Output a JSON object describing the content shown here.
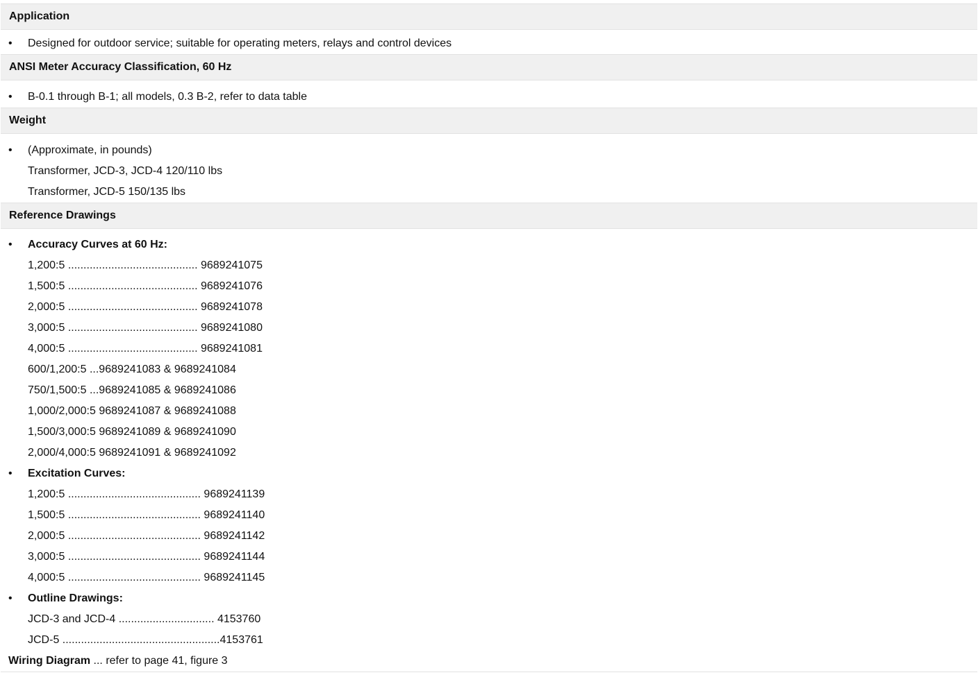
{
  "sections": {
    "application": {
      "title": "Application",
      "items": [
        "Designed for outdoor service; suitable for operating meters, relays and control devices"
      ]
    },
    "accuracy": {
      "title": "ANSI Meter Accuracy Classification, 60 Hz",
      "items": [
        "B-0.1 through B-1; all models, 0.3 B-2, refer to data table"
      ]
    },
    "weight": {
      "title": "Weight",
      "bullet": "(Approximate, in pounds)",
      "lines": [
        "Transformer, JCD-3, JCD-4 120/110 lbs",
        "Transformer, JCD-5 150/135 lbs"
      ]
    },
    "reference": {
      "title": "Reference Drawings",
      "accuracy_curves": {
        "label": "Accuracy Curves at 60 Hz:",
        "lines": [
          "1,200:5 .......................................... 9689241075",
          "1,500:5 .......................................... 9689241076",
          "2,000:5 .......................................... 9689241078",
          "3,000:5 .......................................... 9689241080",
          "4,000:5 .......................................... 9689241081",
          "600/1,200:5 ...9689241083 & 9689241084",
          "750/1,500:5 ...9689241085 & 9689241086",
          "1,000/2,000:5 9689241087 & 9689241088",
          "1,500/3,000:5 9689241089 & 9689241090",
          "2,000/4,000:5 9689241091 & 9689241092"
        ]
      },
      "excitation_curves": {
        "label": "Excitation Curves:",
        "lines": [
          "1,200:5 ........................................... 9689241139",
          "1,500:5 ........................................... 9689241140",
          "2,000:5 ........................................... 9689241142",
          "3,000:5 ........................................... 9689241144",
          "4,000:5 ........................................... 9689241145"
        ]
      },
      "outline_drawings": {
        "label": "Outline Drawings:",
        "lines": [
          "JCD-3 and JCD-4 ............................... 4153760",
          "JCD-5 ...................................................4153761"
        ]
      }
    },
    "wiring": {
      "label": "Wiring Diagram",
      "text": " ... refer to page 41, figure 3"
    }
  },
  "bullet_char": "•"
}
